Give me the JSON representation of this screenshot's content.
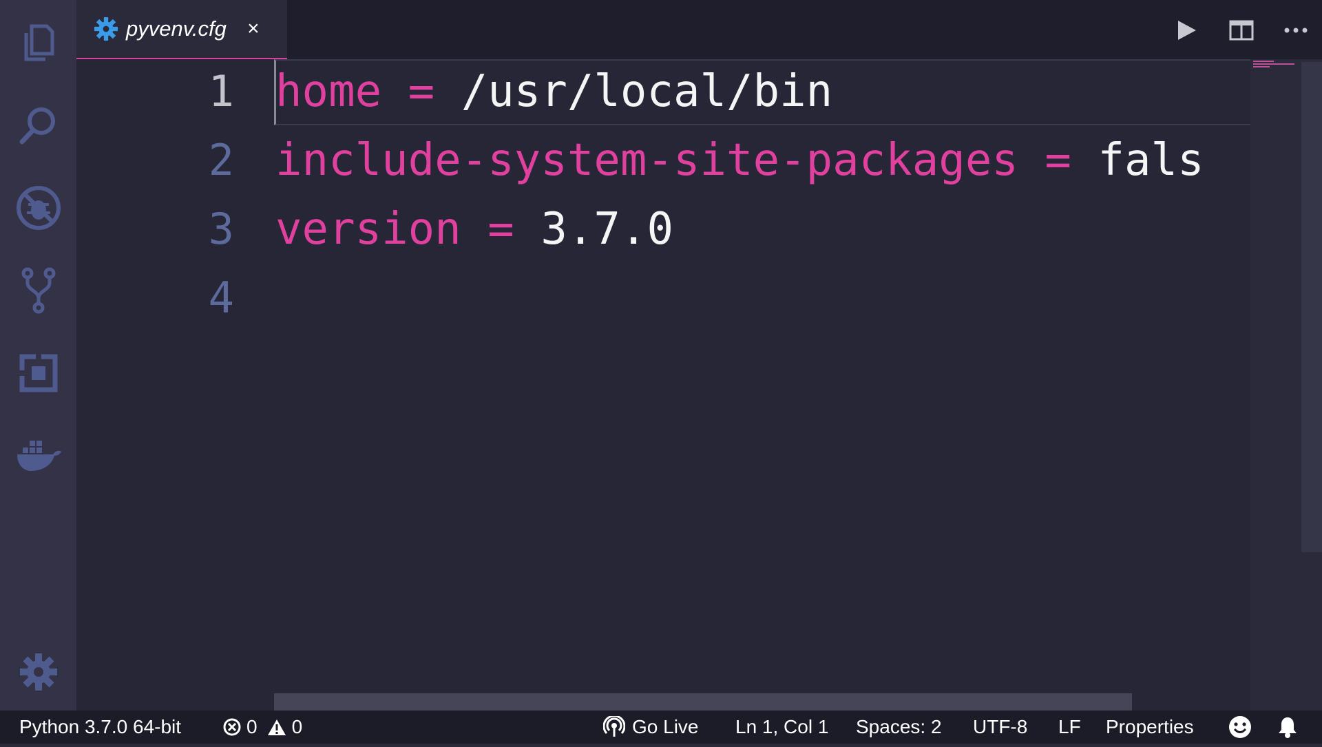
{
  "tab": {
    "filename": "pyvenv.cfg",
    "close": "×"
  },
  "editor": {
    "lines": [
      {
        "number": "1",
        "key": "home",
        "op": " = ",
        "value": "/usr/local/bin"
      },
      {
        "number": "2",
        "key": "include-system-site-packages",
        "op": " = ",
        "value": "fals"
      },
      {
        "number": "3",
        "key": "version",
        "op": " = ",
        "value": "3.7.0"
      },
      {
        "number": "4",
        "key": "",
        "op": "",
        "value": ""
      }
    ],
    "cursor_line": 1
  },
  "activity_bar": {
    "items": [
      "files-icon",
      "search-icon",
      "debug-icon",
      "source-control-icon",
      "extensions-icon",
      "docker-icon"
    ],
    "bottom": "gear-icon"
  },
  "status_bar": {
    "python": "Python 3.7.0 64-bit",
    "errors": "0",
    "warnings": "0",
    "go_live": "Go Live",
    "position": "Ln 1, Col 1",
    "spaces": "Spaces: 2",
    "encoding": "UTF-8",
    "eol": "LF",
    "language": "Properties"
  },
  "colors": {
    "key": "#e0409e",
    "value": "#f5f5f5",
    "accent": "#d9439c",
    "icon": "#5b6aa8"
  }
}
